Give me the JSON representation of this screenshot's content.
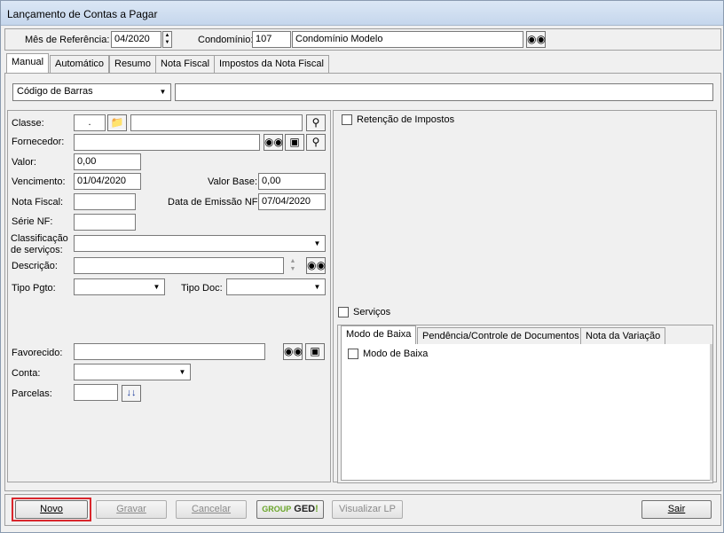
{
  "window": {
    "title": "Lançamento de Contas a Pagar"
  },
  "header": {
    "mes_label": "Mês de Referência:",
    "mes_value": "04/2020",
    "condominio_label": "Condomínio:",
    "condominio_code": "107",
    "condominio_name": "Condomínio Modelo"
  },
  "main_tabs": [
    "Manual",
    "Automático",
    "Resumo",
    "Nota Fiscal",
    "Impostos da Nota Fiscal"
  ],
  "barcode": {
    "type_value": "Código de Barras",
    "value": ""
  },
  "form": {
    "classe_label": "Classe:",
    "classe_code": ".",
    "classe_value": "",
    "fornecedor_label": "Fornecedor:",
    "fornecedor_value": "",
    "valor_label": "Valor:",
    "valor_value": "0,00",
    "vencimento_label": "Vencimento:",
    "vencimento_value": "01/04/2020",
    "valor_base_label": "Valor Base:",
    "valor_base_value": "0,00",
    "nota_fiscal_label": "Nota Fiscal:",
    "nota_fiscal_value": "",
    "data_emissao_label": "Data de Emissão NF:",
    "data_emissao_value": "07/04/2020",
    "serie_nf_label": "Série NF:",
    "serie_nf_value": "",
    "classificacao_label_1": "Classificação",
    "classificacao_label_2": "de serviços:",
    "classificacao_value": "",
    "descricao_label": "Descrição:",
    "descricao_value": "",
    "tipo_pgto_label": "Tipo Pgto:",
    "tipo_pgto_value": "",
    "tipo_doc_label": "Tipo Doc:",
    "tipo_doc_value": "",
    "favorecido_label": "Favorecido:",
    "favorecido_value": "",
    "conta_label": "Conta:",
    "conta_value": "",
    "parcelas_label": "Parcelas:",
    "parcelas_value": ""
  },
  "right_panel": {
    "retencao_label": "Retenção de Impostos",
    "servicos_label": "Serviços",
    "sub_tabs": [
      "Modo de Baixa",
      "Pendência/Controle de Documentos",
      "Nota da Variação"
    ],
    "modo_baixa_label": "Modo de Baixa"
  },
  "footer": {
    "novo": "Novo",
    "gravar": "Gravar",
    "cancelar": "Cancelar",
    "ged_group": "GROUP",
    "ged_label": "GED",
    "visualizar_lp": "Visualizar LP",
    "sair": "Sair"
  },
  "colors": {
    "highlight": "#d9262c",
    "ged_green": "#6aa52a"
  }
}
